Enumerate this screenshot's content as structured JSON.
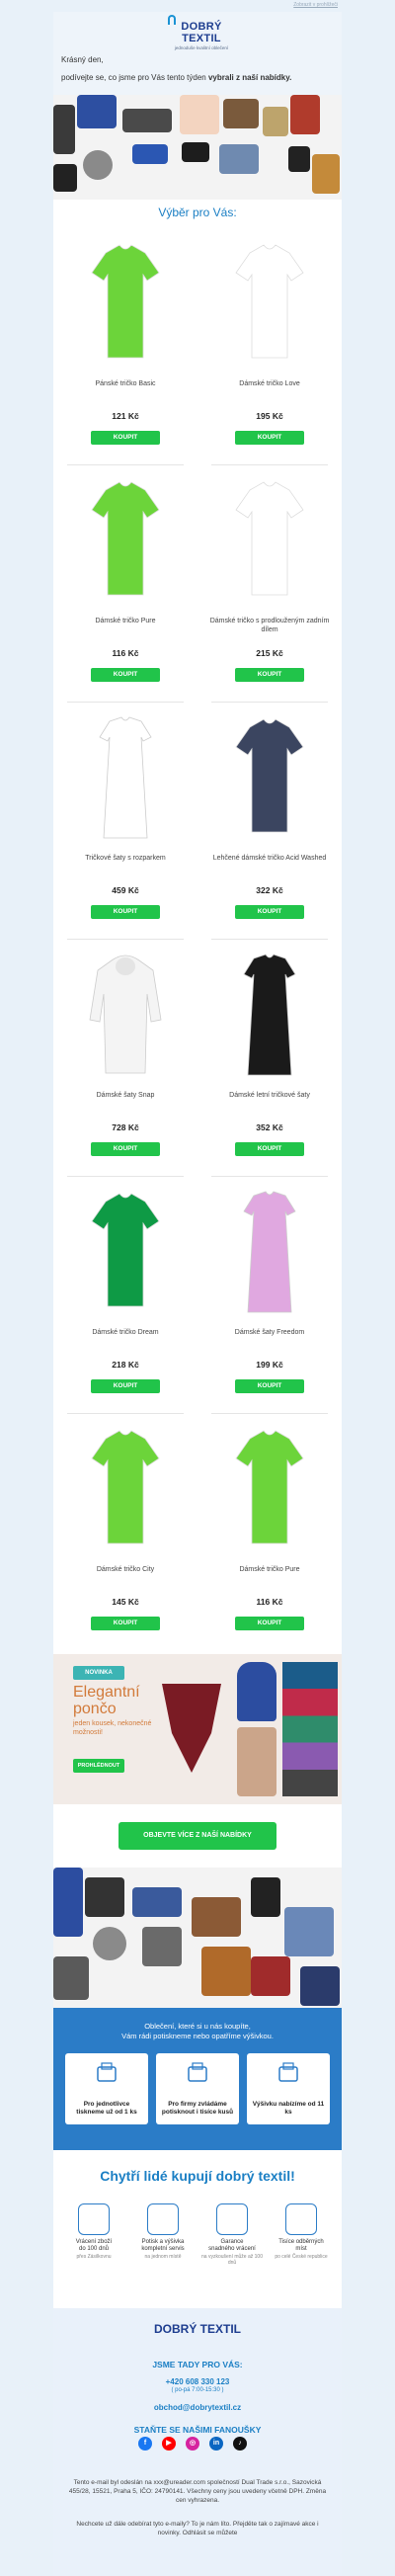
{
  "colors": {
    "brand_blue": "#1b7fc4",
    "button_green": "#21c44a",
    "navy": "#1d3d8f"
  },
  "top_link": "Zobrazit v prohlížeči",
  "header": {
    "logo_name": "DOBRÝ TEXTIL",
    "logo_tagline": "jednoduše kvalitní oblečení"
  },
  "greeting": {
    "hello": "Krásný den,",
    "line_prefix": "podívejte se, co jsme pro Vás tento týden ",
    "line_bold": "vybrali z naší nabídky."
  },
  "section_title": "Výběr pro Vás:",
  "buy_label": "KOUPIT",
  "products": [
    {
      "name": "Pánské tričko Basic",
      "price": "121 Kč",
      "color": "#6cd43a",
      "kind": "tee"
    },
    {
      "name": "Dámské tričko Love",
      "price": "195 Kč",
      "color": "#ffffff",
      "kind": "tee"
    },
    {
      "name": "Dámské tričko Pure",
      "price": "116 Kč",
      "color": "#6cd43a",
      "kind": "tee"
    },
    {
      "name": "Dámské tričko s prodlouženým zadním dílem",
      "price": "215 Kč",
      "color": "#ffffff",
      "kind": "tee"
    },
    {
      "name": "Tričkové šaty s rozparkem",
      "price": "459 Kč",
      "color": "#ffffff",
      "kind": "dress"
    },
    {
      "name": "Lehčené dámské tričko Acid Washed",
      "price": "322 Kč",
      "color": "#3b4560",
      "kind": "tee"
    },
    {
      "name": "Dámské šaty Snap",
      "price": "728 Kč",
      "color": "#f4f4f4",
      "kind": "hoodie"
    },
    {
      "name": "Dámské letní tričkové šaty",
      "price": "352 Kč",
      "color": "#1a1a1a",
      "kind": "dress"
    },
    {
      "name": "Dámské tričko Dream",
      "price": "218 Kč",
      "color": "#0e9a45",
      "kind": "tee"
    },
    {
      "name": "Dámské šaty Freedom",
      "price": "199 Kč",
      "color": "#e0a8e0",
      "kind": "dress"
    },
    {
      "name": "Dámské tričko City",
      "price": "145 Kč",
      "color": "#6cd43a",
      "kind": "tee"
    },
    {
      "name": "Dámské tričko Pure",
      "price": "116 Kč",
      "color": "#6cd43a",
      "kind": "tee"
    }
  ],
  "promo": {
    "badge": "NOVINKA",
    "title": "Elegantní pončo",
    "subtitle": "jeden kousek, nekonečné možnosti!",
    "cta": "PROHLÉDNOUT"
  },
  "more_button": "OBJEVTE VÍCE Z NAŠÍ NABÍDKY",
  "bluebox": {
    "line1": "Oblečení, které si u nás koupíte,",
    "line2": "Vám rádi potiskneme nebo opatříme výšivkou.",
    "features": [
      {
        "text": "Pro jednotlivce tiskneme už od 1 ks",
        "icon": "printer-icon"
      },
      {
        "text": "Pro firmy zvládáme potisknout i tisíce kusů",
        "icon": "stack-shirts-icon"
      },
      {
        "text": "Výšivku nabízíme od 11 ks",
        "icon": "embroidered-shirt-icon"
      }
    ]
  },
  "usp": {
    "title": "Chytří lidé kupují dobrý textil!",
    "items": [
      {
        "head": "Vrácení zboží",
        "desc": "do 100 dnů",
        "line2": "přes Zásilkovnu",
        "icon": "return-box-icon"
      },
      {
        "head": "Potisk a výšivka",
        "desc": "kompletní servis",
        "line2": "na jednom místě",
        "icon": "print-shirt-icon"
      },
      {
        "head": "Garance",
        "desc": "snadného vrácení",
        "line2": "na vyzkoušení může až 100 dnů",
        "icon": "guarantee-100-icon"
      },
      {
        "head": "Tisíce odběrných",
        "desc": "míst",
        "line2": "po celé České republice",
        "icon": "pickup-point-icon"
      }
    ]
  },
  "footer": {
    "logo_name": "DOBRÝ TEXTIL",
    "contact_title": "JSME TADY PRO VÁS:",
    "phone": "+420 608 330 123",
    "hours": "( po-pá 7:00-15:30 )",
    "email": "obchod@dobrytextil.cz",
    "fans_title": "STAŇTE SE NAŠIMI FANOUŠKY",
    "legal": "Tento e-mail byl odeslán na xxx@ureader.com společností Dual Trade s.r.o., Sazovická 455/28, 15521, Praha 5, IČO: 24790141. Všechny ceny jsou uvedeny včetně DPH. Změna cen vyhrazena.",
    "unsub": "Nechcete už dále odebírat tyto e-maily? To je nám líto. Přejděte tak o zajímavé akce i novinky. Odhlásit se můžete",
    "socials": [
      {
        "icon": "facebook-icon",
        "label": "f",
        "color": "#1877f2"
      },
      {
        "icon": "youtube-icon",
        "label": "▶",
        "color": "#ff0000"
      },
      {
        "icon": "instagram-icon",
        "label": "◎",
        "color": "#d6249f"
      },
      {
        "icon": "linkedin-icon",
        "label": "in",
        "color": "#0a66c2"
      },
      {
        "icon": "tiktok-icon",
        "label": "♪",
        "color": "#111111"
      }
    ]
  }
}
